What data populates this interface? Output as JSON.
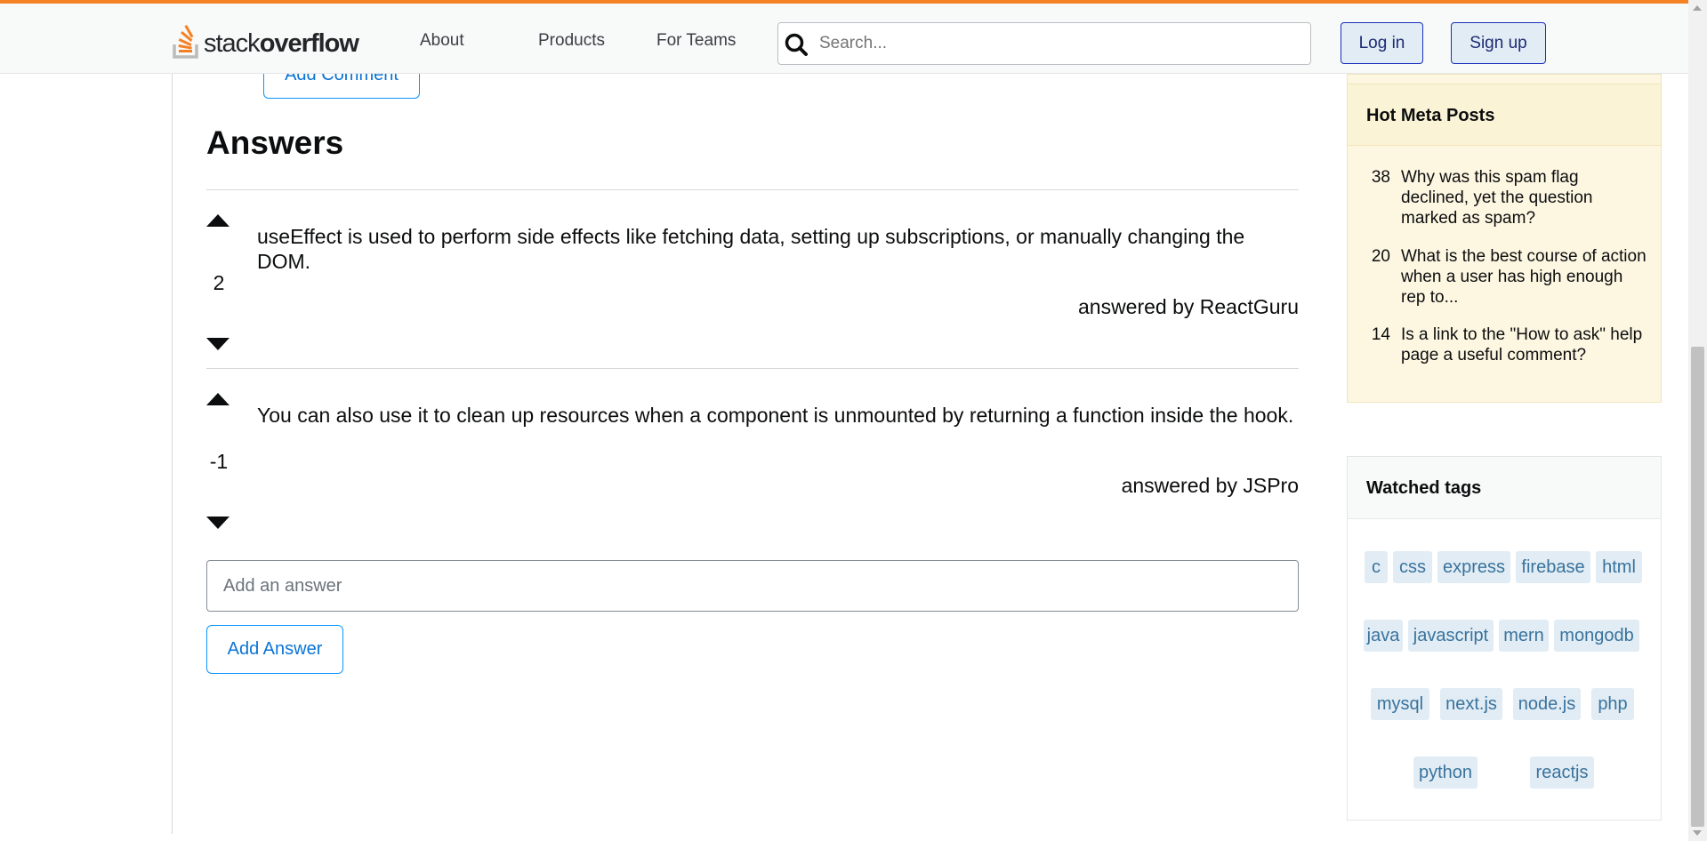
{
  "header": {
    "logo_prefix": "stack",
    "logo_suffix": "overflow",
    "nav": [
      "About",
      "Products",
      "For Teams"
    ],
    "search_placeholder": "Search...",
    "login_label": "Log in",
    "signup_label": "Sign up",
    "accent_color": "#f48225"
  },
  "question": {
    "add_comment_label": "Add Comment"
  },
  "answers": {
    "title": "Answers",
    "items": [
      {
        "votes": "2",
        "body": "useEffect is used to perform side effects like fetching data, setting up subscriptions, or manually changing the DOM.",
        "author_line": "answered by ReactGuru"
      },
      {
        "votes": "-1",
        "body": "You can also use it to clean up resources when a component is unmounted by returning a function inside the hook.",
        "author_line": "answered by JSPro"
      }
    ],
    "input_placeholder": "Add an answer",
    "add_answer_label": "Add Answer"
  },
  "sidebar": {
    "meta_title": "Hot Meta Posts",
    "meta_posts": [
      {
        "count": "38",
        "title": "Why was this spam flag declined, yet the question marked as spam?"
      },
      {
        "count": "20",
        "title": "What is the best course of action when a user has high enough rep to..."
      },
      {
        "count": "14",
        "title": "Is a link to the \"How to ask\" help page a useful comment?"
      }
    ],
    "tags_title": "Watched tags",
    "tags": [
      "c",
      "css",
      "express",
      "firebase",
      "html",
      "java",
      "javascript",
      "mern",
      "mongodb",
      "mysql",
      "next.js",
      "node.js",
      "php",
      "python",
      "reactjs"
    ]
  }
}
